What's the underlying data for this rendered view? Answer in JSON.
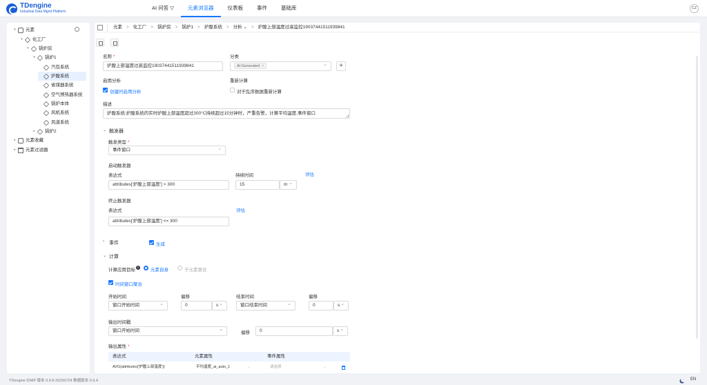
{
  "brand": {
    "name": "TDengine",
    "subtitle": "Industrial Data Mgmt Platform"
  },
  "nav": [
    "AI 问答 ▽",
    "元素浏览器",
    "仪表板",
    "事件",
    "基础库"
  ],
  "user": {
    "initials": "CZ"
  },
  "tree": [
    {
      "label": "元素",
      "caret": "▾",
      "icon": "hierarchy-icon"
    },
    {
      "label": "化工厂",
      "caret": "▾",
      "icon": "cube-icon"
    },
    {
      "label": "锅炉房",
      "caret": "▾",
      "icon": "cube-icon"
    },
    {
      "label": "锅炉1",
      "caret": "▾",
      "icon": "cube-icon"
    },
    {
      "label": "汽包系统",
      "caret": "",
      "icon": "cube-icon"
    },
    {
      "label": "炉膛系统",
      "caret": "",
      "icon": "cube-icon",
      "selected": true
    },
    {
      "label": "省煤器系统",
      "caret": "",
      "icon": "cube-icon"
    },
    {
      "label": "空气预热器系统",
      "caret": "",
      "icon": "cube-icon"
    },
    {
      "label": "锅炉本体",
      "caret": "",
      "icon": "cube-icon"
    },
    {
      "label": "风机系统",
      "caret": "",
      "icon": "cube-icon"
    },
    {
      "label": "风道系统",
      "caret": "",
      "icon": "cube-icon"
    },
    {
      "label": "锅炉2",
      "caret": "▸",
      "icon": "cube-icon"
    },
    {
      "label": "元素收藏",
      "caret": "▸",
      "icon": "folder-icon"
    },
    {
      "label": "元素过滤器",
      "caret": "▸",
      "icon": "filter-icon"
    }
  ],
  "breadcrumb": [
    "元素",
    "化工厂",
    "锅炉房",
    "锅炉1",
    "炉膛系统",
    "分析 ⌄",
    "炉膛上部温度过高监控190374415119398​41"
  ],
  "form": {
    "name_label": "名称",
    "name_value": "炉膛上部温度过高监控19037441511939841",
    "category_label": "分类",
    "category_tag": "AI-Generated",
    "enable_label": "启用分析",
    "enable_checkbox": "创建时启用分析",
    "recalc_label": "重新计算",
    "recalc_checkbox": "对于乱序数据重新计算",
    "desc_label": "描述",
    "desc_value": "炉膛系统:炉膛系统的实时炉膛上部温度超过300°C持续超过15分钟时，严重告警，计算平均温度,事件窗口"
  },
  "trigger": {
    "section": "触发器",
    "type_label": "触发类型",
    "type_value": "事件窗口",
    "start_label": "启动触发器",
    "expr_label": "表达式",
    "start_expr": "attributes['炉膛上部温度'] > 300",
    "duration_label": "持续时间",
    "duration_value": "15",
    "duration_unit": "m",
    "evaluate": "评估",
    "stop_label": "终止触发器",
    "stop_expr_label": "表达式",
    "stop_evaluate": "评估",
    "stop_expr": "attributes['炉膛上部温度'] <= 300"
  },
  "event": {
    "section": "事件",
    "generate": "生成"
  },
  "calc": {
    "section": "计算",
    "target_label": "计算应用目标",
    "target_self": "元素自身",
    "target_child": "子元素聚合",
    "window_agg": "时间窗口聚合",
    "start_time_label": "开始时间",
    "start_time_value": "窗口开始时间",
    "offset_label": "偏移",
    "offset_value": "0",
    "offset_unit": "s",
    "end_time_label": "结束时间",
    "end_time_value": "窗口结束时间",
    "end_offset_label": "偏移",
    "end_offset_value": "0",
    "end_offset_unit": "s",
    "output_ts_label": "输出时间戳",
    "output_ts_value": "窗口开始时间",
    "output_offset_label": "偏移",
    "output_offset_value": "0",
    "output_offset_unit": "s",
    "output_attr_label": "输出属性",
    "table_headers": [
      "表达式",
      "元素属性",
      "事件属性"
    ],
    "table_row": {
      "expr": "AVG(attributes['炉膛上部温度'])",
      "attr": "平均温度_ai_auto_1",
      "event_attr": "请选择"
    }
  },
  "footer": {
    "version": "TDengine IDMP 版本 0.9.8-20250724 数据版本 0.9.4",
    "lang": "EN"
  }
}
